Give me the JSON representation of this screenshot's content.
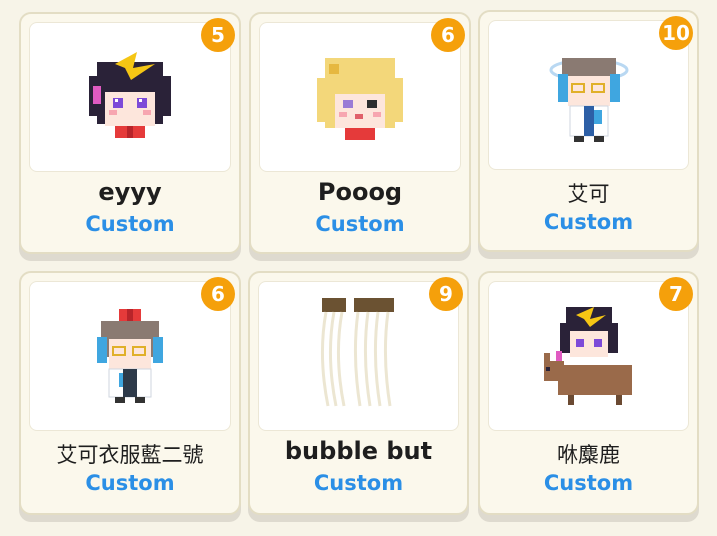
{
  "cards": [
    {
      "name": "eyyy",
      "count": "5",
      "tag": "Custom"
    },
    {
      "name": "Pooog",
      "count": "6",
      "tag": "Custom"
    },
    {
      "name": "艾可",
      "count": "10",
      "tag": "Custom"
    },
    {
      "name": "艾可衣服藍二號",
      "count": "6",
      "tag": "Custom"
    },
    {
      "name": "bubble but",
      "count": "9",
      "tag": "Custom"
    },
    {
      "name": "咻麋鹿",
      "count": "7",
      "tag": "Custom"
    }
  ],
  "colors": {
    "badge": "#f5a00b",
    "tag": "#2b8fe6",
    "card_bg": "#fbf8ec"
  }
}
